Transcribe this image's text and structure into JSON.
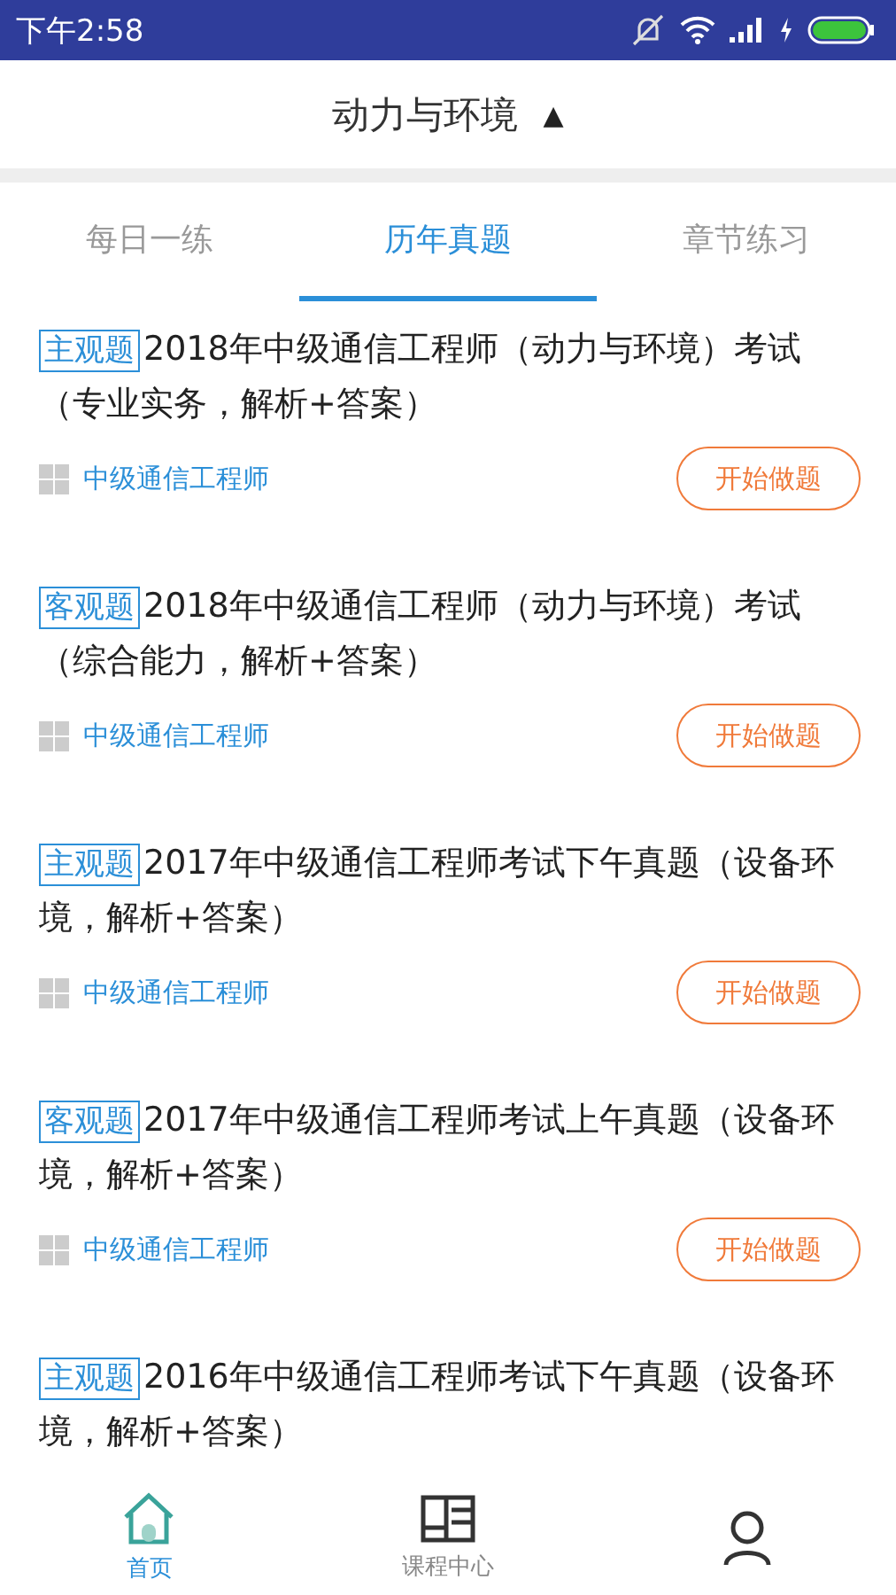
{
  "status_bar": {
    "time": "下午2:58"
  },
  "header": {
    "title": "动力与环境",
    "arrow": "▲"
  },
  "tabs": [
    {
      "label": "每日一练",
      "selected": false
    },
    {
      "label": "历年真题",
      "selected": true
    },
    {
      "label": "章节练习",
      "selected": false
    }
  ],
  "exams": [
    {
      "tag": "主观题",
      "title": "2018年中级通信工程师（动力与环境）考试（专业实务，解析+答案）",
      "category": "中级通信工程师",
      "action": "开始做题"
    },
    {
      "tag": "客观题",
      "title": "2018年中级通信工程师（动力与环境）考试（综合能力，解析+答案）",
      "category": "中级通信工程师",
      "action": "开始做题"
    },
    {
      "tag": "主观题",
      "title": "2017年中级通信工程师考试下午真题（设备环境，解析+答案）",
      "category": "中级通信工程师",
      "action": "开始做题"
    },
    {
      "tag": "客观题",
      "title": "2017年中级通信工程师考试上午真题（设备环境，解析+答案）",
      "category": "中级通信工程师",
      "action": "开始做题"
    },
    {
      "tag": "主观题",
      "title": "2016年中级通信工程师考试下午真题（设备环境，解析+答案）"
    }
  ],
  "bottom_nav": [
    {
      "kind": "home",
      "label": "首页",
      "selected": true
    },
    {
      "kind": "course",
      "label": "课程中心",
      "selected": false
    },
    {
      "kind": "profile",
      "selected": false
    }
  ]
}
